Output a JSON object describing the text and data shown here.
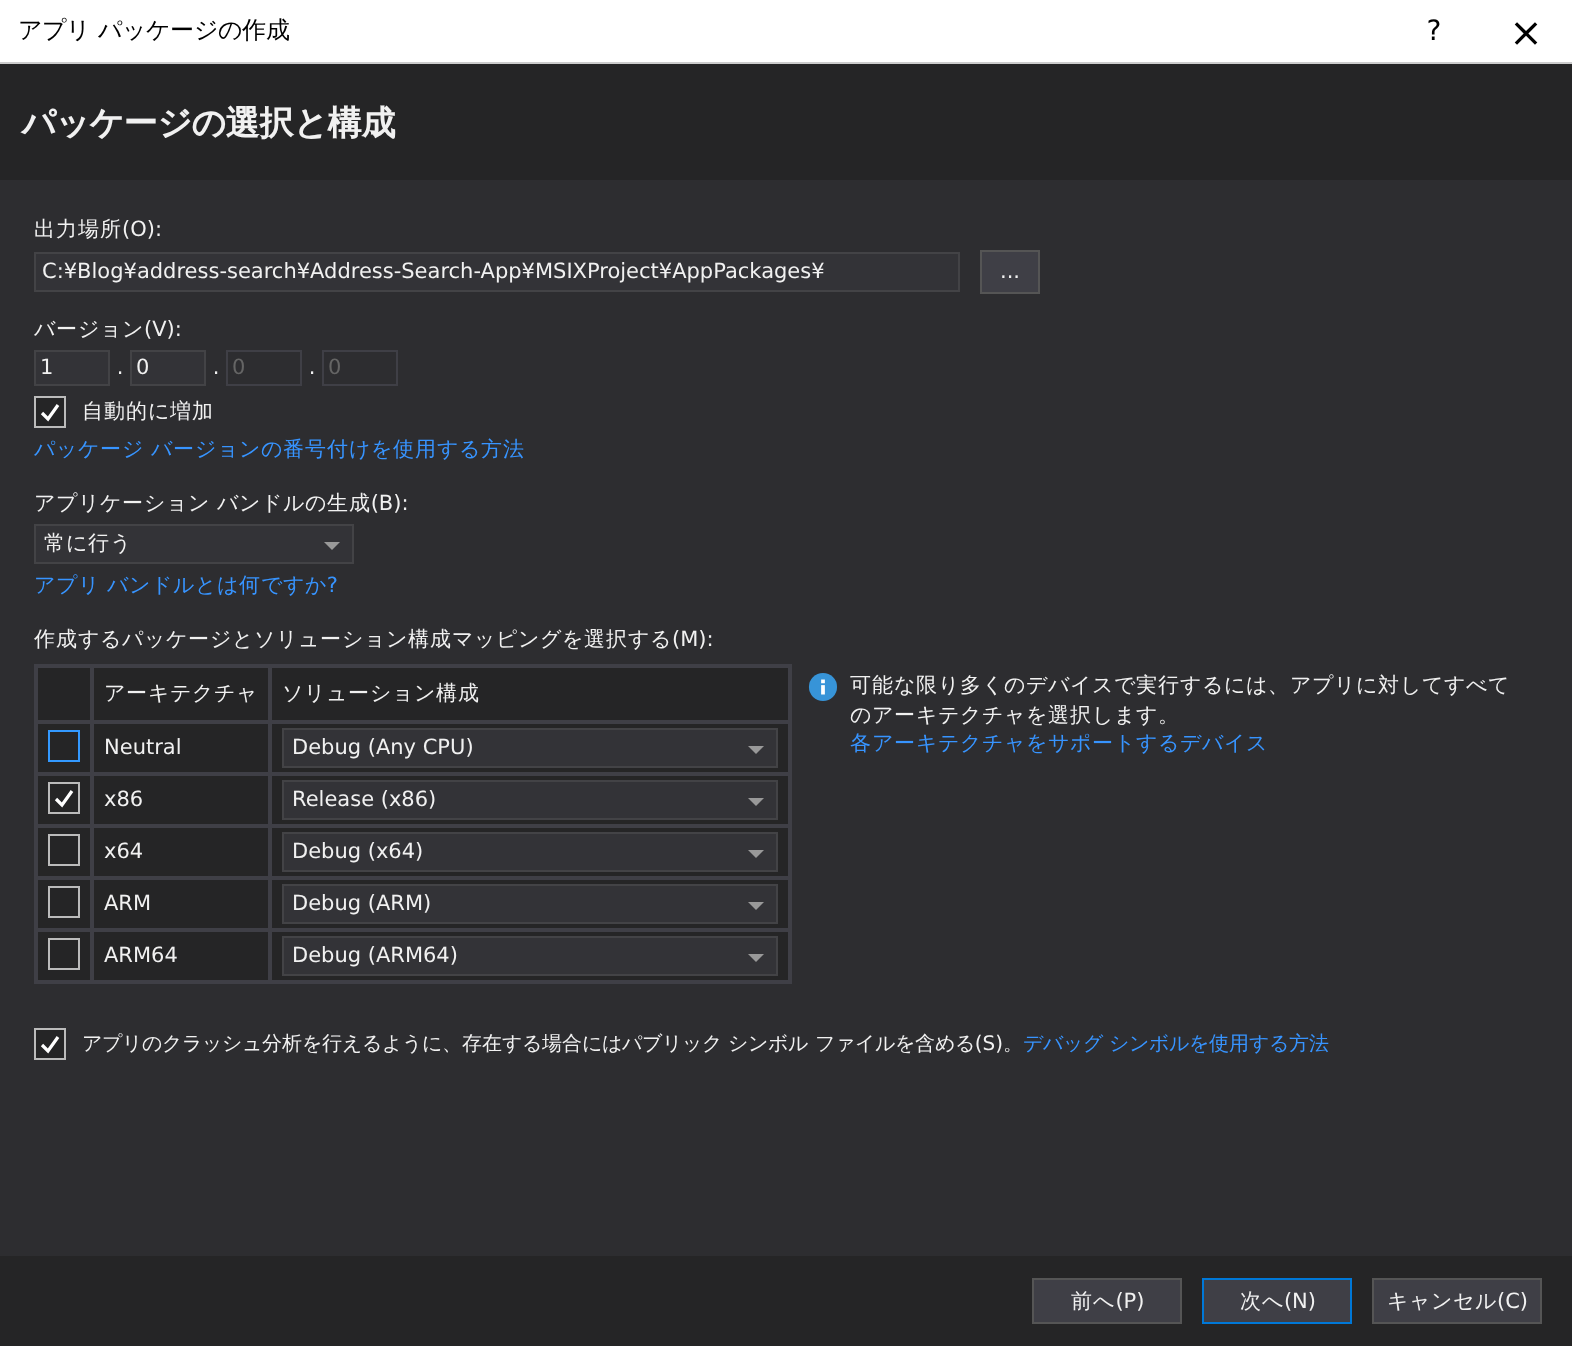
{
  "window": {
    "title": "アプリ パッケージの作成",
    "help": "?",
    "close": "×"
  },
  "header": {
    "title": "パッケージの選択と構成"
  },
  "output": {
    "label": "出力場所(O):",
    "value": "C:¥Blog¥address-search¥Address-Search-App¥MSIXProject¥AppPackages¥",
    "browse": "..."
  },
  "version": {
    "label": "バージョン(V):",
    "separator": ".",
    "parts": [
      {
        "value": "1",
        "disabled": false
      },
      {
        "value": "0",
        "disabled": false
      },
      {
        "value": "0",
        "disabled": true
      },
      {
        "value": "0",
        "disabled": true
      }
    ]
  },
  "auto_increment": {
    "label": "自動的に増加",
    "checked": true
  },
  "version_link": "パッケージ バージョンの番号付けを使用する方法",
  "bundle": {
    "label": "アプリケーション バンドルの生成(B):",
    "value": "常に行う",
    "link": "アプリ バンドルとは何ですか?"
  },
  "mapping": {
    "label": "作成するパッケージとソリューション構成マッピングを選択する(M):",
    "columns": [
      "アーキテクチャ",
      "ソリューション構成"
    ],
    "rows": [
      {
        "architecture": "Neutral",
        "configuration": "Debug (Any CPU)",
        "checked": false
      },
      {
        "architecture": "x86",
        "configuration": "Release (x86)",
        "checked": true
      },
      {
        "architecture": "x64",
        "configuration": "Debug (x64)",
        "checked": false
      },
      {
        "architecture": "ARM",
        "configuration": "Debug (ARM)",
        "checked": false
      },
      {
        "architecture": "ARM64",
        "configuration": "Debug (ARM64)",
        "checked": false
      }
    ]
  },
  "info": {
    "text": "可能な限り多くのデバイスで実行するには、アプリに対してすべてのアーキテクチャを選択します。",
    "link": "各アーキテクチャをサポートするデバイス"
  },
  "symbols": {
    "label": "アプリのクラッシュ分析を行えるように、存在する場合にはパブリック シンボル ファイルを含める(S)。",
    "checked": true,
    "link": "デバッグ シンボルを使用する方法"
  },
  "buttons": [
    {
      "label": "前へ(P)",
      "selected": false
    },
    {
      "label": "次へ(N)",
      "selected": true
    },
    {
      "label": "キャンセル(C)",
      "selected": false
    }
  ]
}
